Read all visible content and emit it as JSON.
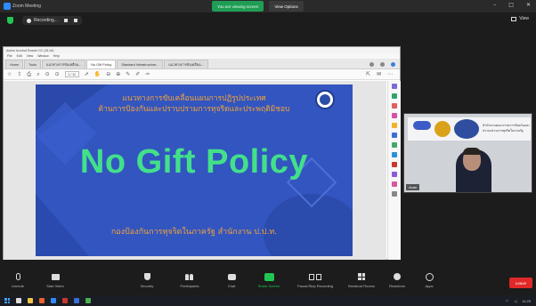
{
  "window": {
    "title": "Zoom Meeting"
  },
  "share_banner": {
    "status": "You are viewing screen",
    "view_options": "View Options"
  },
  "meeting": {
    "recording": "Recording...",
    "view": "View"
  },
  "browser": {
    "title": "Adobe Acrobat Reader DC (64-bit)",
    "menus": [
      "File",
      "Edit",
      "View",
      "Window",
      "Help"
    ],
    "tabs": [
      "Home",
      "Tools",
      "แนวทางการขับเคลื่อน...",
      "No Gift Policy",
      "Standard Infrastructure...",
      "แนวทางการขับเคลื่อน..."
    ],
    "active_tab_index": 3,
    "page_number": "1 / 11"
  },
  "slide": {
    "line1": "แนวทางการขับเคลื่อนแผนการปฏิรูปประเทศ",
    "line2": "ด้านการป้องกันและปราบปรามการทุจริตและประพฤติมิชอบ",
    "main": "No Gift Policy",
    "footer": "กองป้องกันการทุจริตในภาครัฐ สำนักงาน ป.ป.ท."
  },
  "video": {
    "participant_name": "Anan",
    "banner_text": "สำนักงานคณะกรรมการป้องกันและปราบปรามการทุจริตในภาครัฐ"
  },
  "controls": {
    "unmute": "Unmute",
    "start_video": "Start Video",
    "security": "Security",
    "participants": "Participants",
    "chat": "Chat",
    "share_screen": "Share Screen",
    "pause_recording": "Pause/Stop Recording",
    "breakout_rooms": "Breakout Rooms",
    "reactions": "Reactions",
    "apps": "Apps",
    "end": "Leave"
  },
  "taskbar": {
    "time": "11:29"
  },
  "colors": {
    "slide_bg": "#3255c0",
    "slide_title": "#43e08a",
    "slide_text": "#f4a338",
    "share_green": "#1f9d55",
    "end_red": "#e02828"
  }
}
